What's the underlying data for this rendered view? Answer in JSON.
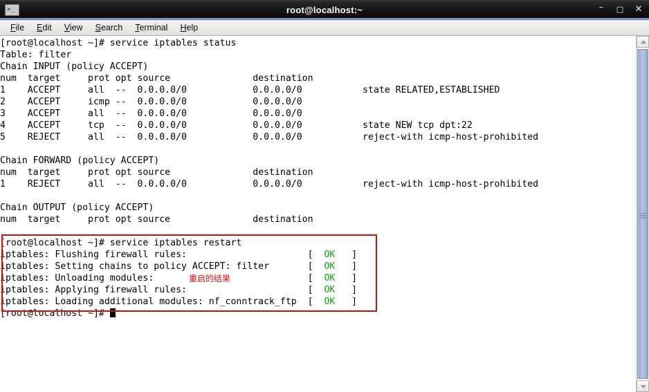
{
  "window": {
    "title": "root@localhost:~",
    "icon": "terminal-icon",
    "controls": {
      "minimize": "–",
      "maximize": "□",
      "close": "✕"
    }
  },
  "menubar": {
    "items": [
      {
        "label": "File",
        "mnemonic": "F",
        "rest": "ile"
      },
      {
        "label": "Edit",
        "mnemonic": "E",
        "rest": "dit"
      },
      {
        "label": "View",
        "mnemonic": "V",
        "rest": "iew"
      },
      {
        "label": "Search",
        "mnemonic": "S",
        "rest": "earch"
      },
      {
        "label": "Terminal",
        "mnemonic": "T",
        "rest": "erminal"
      },
      {
        "label": "Help",
        "mnemonic": "H",
        "rest": "elp"
      }
    ]
  },
  "terminal": {
    "background_color": "#ffffff",
    "foreground_color": "#000000",
    "ok_color": "#12a012",
    "lines": [
      "[root@localhost ~]# service iptables status",
      "Table: filter",
      "Chain INPUT (policy ACCEPT)",
      "num  target     prot opt source               destination",
      "1    ACCEPT     all  --  0.0.0.0/0            0.0.0.0/0           state RELATED,ESTABLISHED",
      "2    ACCEPT     icmp --  0.0.0.0/0            0.0.0.0/0",
      "3    ACCEPT     all  --  0.0.0.0/0            0.0.0.0/0",
      "4    ACCEPT     tcp  --  0.0.0.0/0            0.0.0.0/0           state NEW tcp dpt:22",
      "5    REJECT     all  --  0.0.0.0/0            0.0.0.0/0           reject-with icmp-host-prohibited",
      "",
      "Chain FORWARD (policy ACCEPT)",
      "num  target     prot opt source               destination",
      "1    REJECT     all  --  0.0.0.0/0            0.0.0.0/0           reject-with icmp-host-prohibited",
      "",
      "Chain OUTPUT (policy ACCEPT)",
      "num  target     prot opt source               destination",
      ""
    ],
    "restart_block": {
      "command_line": "[root@localhost ~]# service iptables restart",
      "status_lines": [
        {
          "text": "iptables: Flushing firewall rules:",
          "bracket_open": "[",
          "status": "OK",
          "bracket_close": "]"
        },
        {
          "text": "iptables: Setting chains to policy ACCEPT: filter",
          "bracket_open": "[",
          "status": "OK",
          "bracket_close": "]"
        },
        {
          "text": "iptables: Unloading modules:",
          "bracket_open": "[",
          "status": "OK",
          "bracket_close": "]"
        },
        {
          "text": "iptables: Applying firewall rules:",
          "bracket_open": "[",
          "status": "OK",
          "bracket_close": "]"
        },
        {
          "text": "iptables: Loading additional modules: nf_conntrack_ftp",
          "bracket_open": "[",
          "status": "OK",
          "bracket_close": "]"
        }
      ]
    },
    "final_prompt": "[root@localhost ~]# "
  },
  "annotation": {
    "label": "重启的结果",
    "color": "#dd1111",
    "box_color": "#cc1111"
  },
  "scrollbar": {
    "up_arrow": "scroll-up-arrow",
    "down_arrow": "scroll-down-arrow",
    "thumb": "scroll-thumb"
  }
}
